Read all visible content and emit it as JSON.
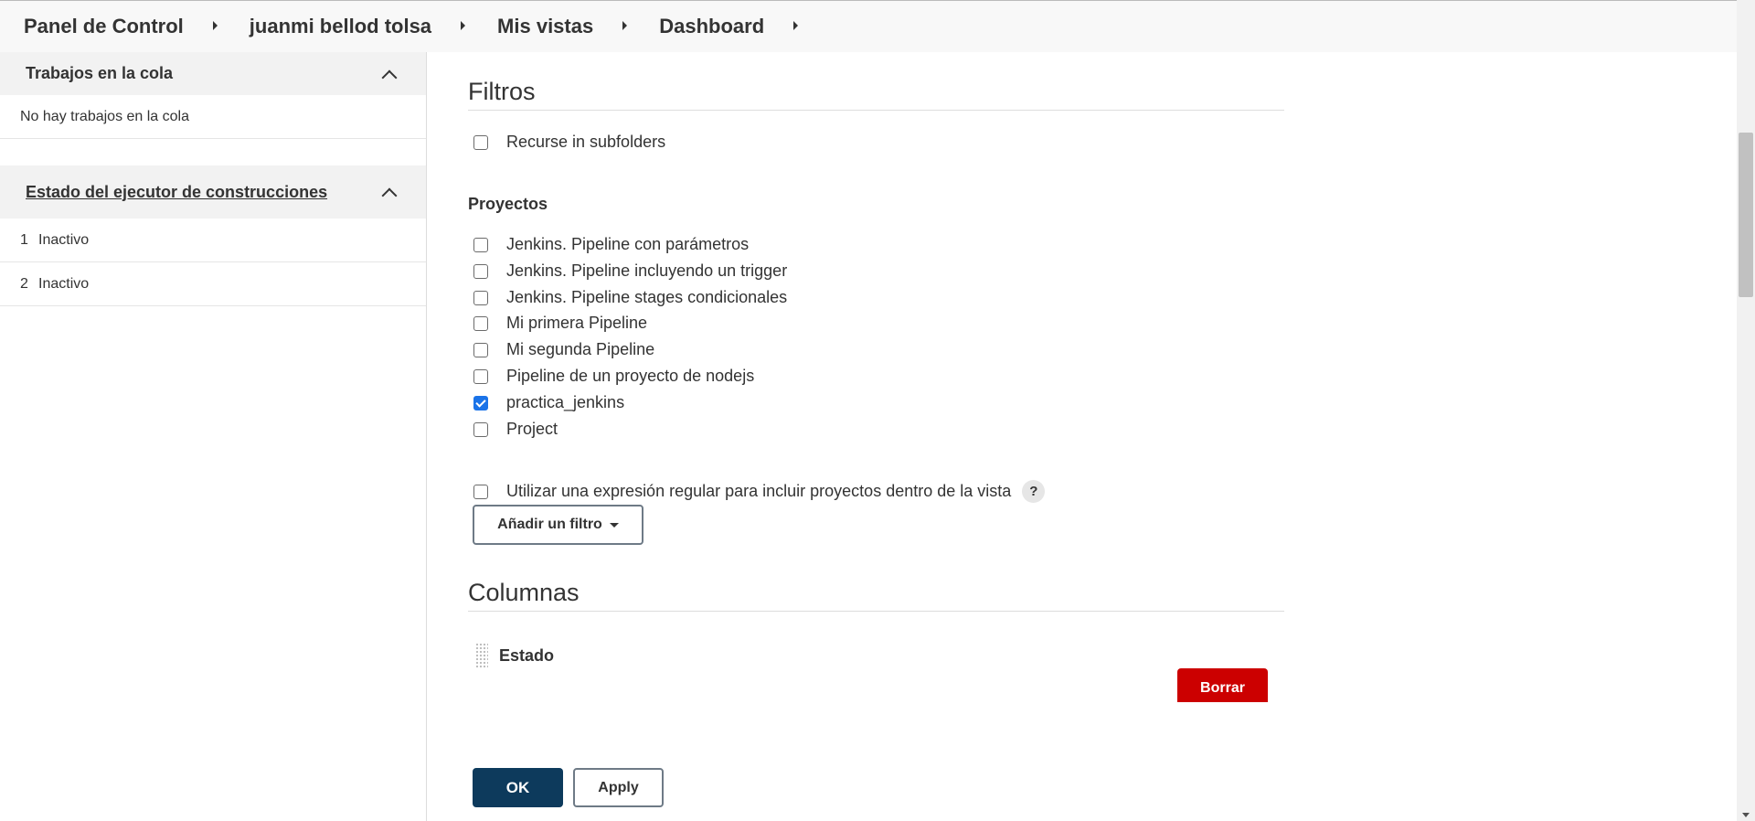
{
  "breadcrumb": {
    "items": [
      {
        "label": "Panel de Control"
      },
      {
        "label": "juanmi bellod tolsa"
      },
      {
        "label": "Mis vistas"
      },
      {
        "label": "Dashboard"
      }
    ]
  },
  "sidebar": {
    "queue": {
      "title": "Trabajos en la cola",
      "empty_text": "No hay trabajos en la cola"
    },
    "executors": {
      "title": "Estado del ejecutor de construcciones",
      "items": [
        {
          "num": "1",
          "status": "Inactivo"
        },
        {
          "num": "2",
          "status": "Inactivo"
        }
      ]
    }
  },
  "filters": {
    "title": "Filtros",
    "recurse_label": "Recurse in subfolders",
    "projects_label": "Proyectos",
    "projects": [
      {
        "label": "Jenkins. Pipeline con parámetros",
        "checked": false
      },
      {
        "label": "Jenkins. Pipeline incluyendo un trigger",
        "checked": false
      },
      {
        "label": "Jenkins. Pipeline stages condicionales",
        "checked": false
      },
      {
        "label": "Mi primera Pipeline",
        "checked": false
      },
      {
        "label": "Mi segunda Pipeline",
        "checked": false
      },
      {
        "label": "Pipeline de un proyecto de nodejs",
        "checked": false
      },
      {
        "label": "practica_jenkins",
        "checked": true
      },
      {
        "label": "Project",
        "checked": false
      }
    ],
    "regex_label": "Utilizar una expresión regular para incluir proyectos dentro de la vista",
    "help_glyph": "?",
    "add_filter_label": "Añadir un filtro"
  },
  "columns": {
    "title": "Columnas",
    "items": [
      {
        "name": "Estado"
      }
    ],
    "delete_label": "Borrar"
  },
  "actions": {
    "ok_label": "OK",
    "apply_label": "Apply"
  },
  "colors": {
    "primary": "#0d3a5c",
    "danger": "#cc0000",
    "checkbox_checked": "#1a73e8"
  }
}
